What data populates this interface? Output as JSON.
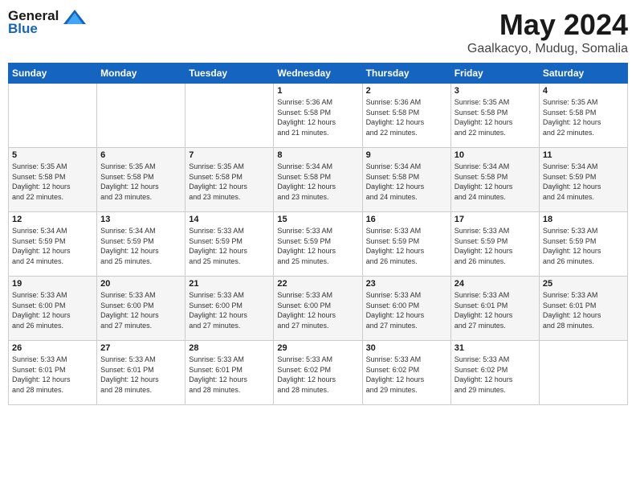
{
  "logo": {
    "line1": "General",
    "line2": "Blue"
  },
  "title": "May 2024",
  "location": "Gaalkacyo, Mudug, Somalia",
  "weekdays": [
    "Sunday",
    "Monday",
    "Tuesday",
    "Wednesday",
    "Thursday",
    "Friday",
    "Saturday"
  ],
  "weeks": [
    [
      {
        "day": "",
        "info": ""
      },
      {
        "day": "",
        "info": ""
      },
      {
        "day": "",
        "info": ""
      },
      {
        "day": "1",
        "info": "Sunrise: 5:36 AM\nSunset: 5:58 PM\nDaylight: 12 hours\nand 21 minutes."
      },
      {
        "day": "2",
        "info": "Sunrise: 5:36 AM\nSunset: 5:58 PM\nDaylight: 12 hours\nand 22 minutes."
      },
      {
        "day": "3",
        "info": "Sunrise: 5:35 AM\nSunset: 5:58 PM\nDaylight: 12 hours\nand 22 minutes."
      },
      {
        "day": "4",
        "info": "Sunrise: 5:35 AM\nSunset: 5:58 PM\nDaylight: 12 hours\nand 22 minutes."
      }
    ],
    [
      {
        "day": "5",
        "info": "Sunrise: 5:35 AM\nSunset: 5:58 PM\nDaylight: 12 hours\nand 22 minutes."
      },
      {
        "day": "6",
        "info": "Sunrise: 5:35 AM\nSunset: 5:58 PM\nDaylight: 12 hours\nand 23 minutes."
      },
      {
        "day": "7",
        "info": "Sunrise: 5:35 AM\nSunset: 5:58 PM\nDaylight: 12 hours\nand 23 minutes."
      },
      {
        "day": "8",
        "info": "Sunrise: 5:34 AM\nSunset: 5:58 PM\nDaylight: 12 hours\nand 23 minutes."
      },
      {
        "day": "9",
        "info": "Sunrise: 5:34 AM\nSunset: 5:58 PM\nDaylight: 12 hours\nand 24 minutes."
      },
      {
        "day": "10",
        "info": "Sunrise: 5:34 AM\nSunset: 5:58 PM\nDaylight: 12 hours\nand 24 minutes."
      },
      {
        "day": "11",
        "info": "Sunrise: 5:34 AM\nSunset: 5:59 PM\nDaylight: 12 hours\nand 24 minutes."
      }
    ],
    [
      {
        "day": "12",
        "info": "Sunrise: 5:34 AM\nSunset: 5:59 PM\nDaylight: 12 hours\nand 24 minutes."
      },
      {
        "day": "13",
        "info": "Sunrise: 5:34 AM\nSunset: 5:59 PM\nDaylight: 12 hours\nand 25 minutes."
      },
      {
        "day": "14",
        "info": "Sunrise: 5:33 AM\nSunset: 5:59 PM\nDaylight: 12 hours\nand 25 minutes."
      },
      {
        "day": "15",
        "info": "Sunrise: 5:33 AM\nSunset: 5:59 PM\nDaylight: 12 hours\nand 25 minutes."
      },
      {
        "day": "16",
        "info": "Sunrise: 5:33 AM\nSunset: 5:59 PM\nDaylight: 12 hours\nand 26 minutes."
      },
      {
        "day": "17",
        "info": "Sunrise: 5:33 AM\nSunset: 5:59 PM\nDaylight: 12 hours\nand 26 minutes."
      },
      {
        "day": "18",
        "info": "Sunrise: 5:33 AM\nSunset: 5:59 PM\nDaylight: 12 hours\nand 26 minutes."
      }
    ],
    [
      {
        "day": "19",
        "info": "Sunrise: 5:33 AM\nSunset: 6:00 PM\nDaylight: 12 hours\nand 26 minutes."
      },
      {
        "day": "20",
        "info": "Sunrise: 5:33 AM\nSunset: 6:00 PM\nDaylight: 12 hours\nand 27 minutes."
      },
      {
        "day": "21",
        "info": "Sunrise: 5:33 AM\nSunset: 6:00 PM\nDaylight: 12 hours\nand 27 minutes."
      },
      {
        "day": "22",
        "info": "Sunrise: 5:33 AM\nSunset: 6:00 PM\nDaylight: 12 hours\nand 27 minutes."
      },
      {
        "day": "23",
        "info": "Sunrise: 5:33 AM\nSunset: 6:00 PM\nDaylight: 12 hours\nand 27 minutes."
      },
      {
        "day": "24",
        "info": "Sunrise: 5:33 AM\nSunset: 6:01 PM\nDaylight: 12 hours\nand 27 minutes."
      },
      {
        "day": "25",
        "info": "Sunrise: 5:33 AM\nSunset: 6:01 PM\nDaylight: 12 hours\nand 28 minutes."
      }
    ],
    [
      {
        "day": "26",
        "info": "Sunrise: 5:33 AM\nSunset: 6:01 PM\nDaylight: 12 hours\nand 28 minutes."
      },
      {
        "day": "27",
        "info": "Sunrise: 5:33 AM\nSunset: 6:01 PM\nDaylight: 12 hours\nand 28 minutes."
      },
      {
        "day": "28",
        "info": "Sunrise: 5:33 AM\nSunset: 6:01 PM\nDaylight: 12 hours\nand 28 minutes."
      },
      {
        "day": "29",
        "info": "Sunrise: 5:33 AM\nSunset: 6:02 PM\nDaylight: 12 hours\nand 28 minutes."
      },
      {
        "day": "30",
        "info": "Sunrise: 5:33 AM\nSunset: 6:02 PM\nDaylight: 12 hours\nand 29 minutes."
      },
      {
        "day": "31",
        "info": "Sunrise: 5:33 AM\nSunset: 6:02 PM\nDaylight: 12 hours\nand 29 minutes."
      },
      {
        "day": "",
        "info": ""
      }
    ]
  ]
}
